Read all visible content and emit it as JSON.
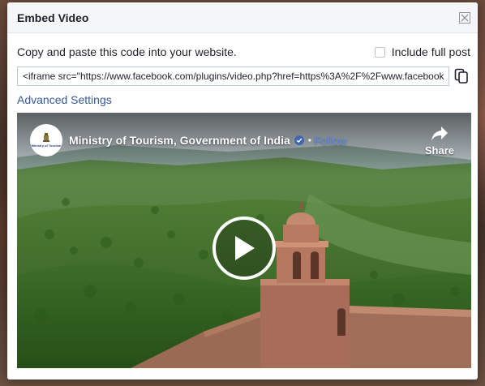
{
  "dialog": {
    "title": "Embed Video",
    "instructions": "Copy and paste this code into your website.",
    "include_full_post_label": "Include full post",
    "include_full_post_checked": false,
    "embed_code": "<iframe src=\"https://www.facebook.com/plugins/video.php?href=https%3A%2F%2Fwww.facebook.com%2F",
    "advanced_settings_label": "Advanced Settings"
  },
  "video": {
    "page_name": "Ministry of Tourism, Government of India",
    "separator": "•",
    "follow_label": "Follow",
    "share_label": "Share",
    "avatar_text": "Ministry of Tourism"
  },
  "icons": {
    "close": "close-icon",
    "copy": "copy-icon",
    "verified": "verified-badge-icon",
    "share": "share-arrow-icon",
    "play": "play-icon"
  },
  "colors": {
    "link": "#385898",
    "follow": "#5b8ef0",
    "verified": "#4267b2",
    "header_bg": "#f5f6f7"
  }
}
